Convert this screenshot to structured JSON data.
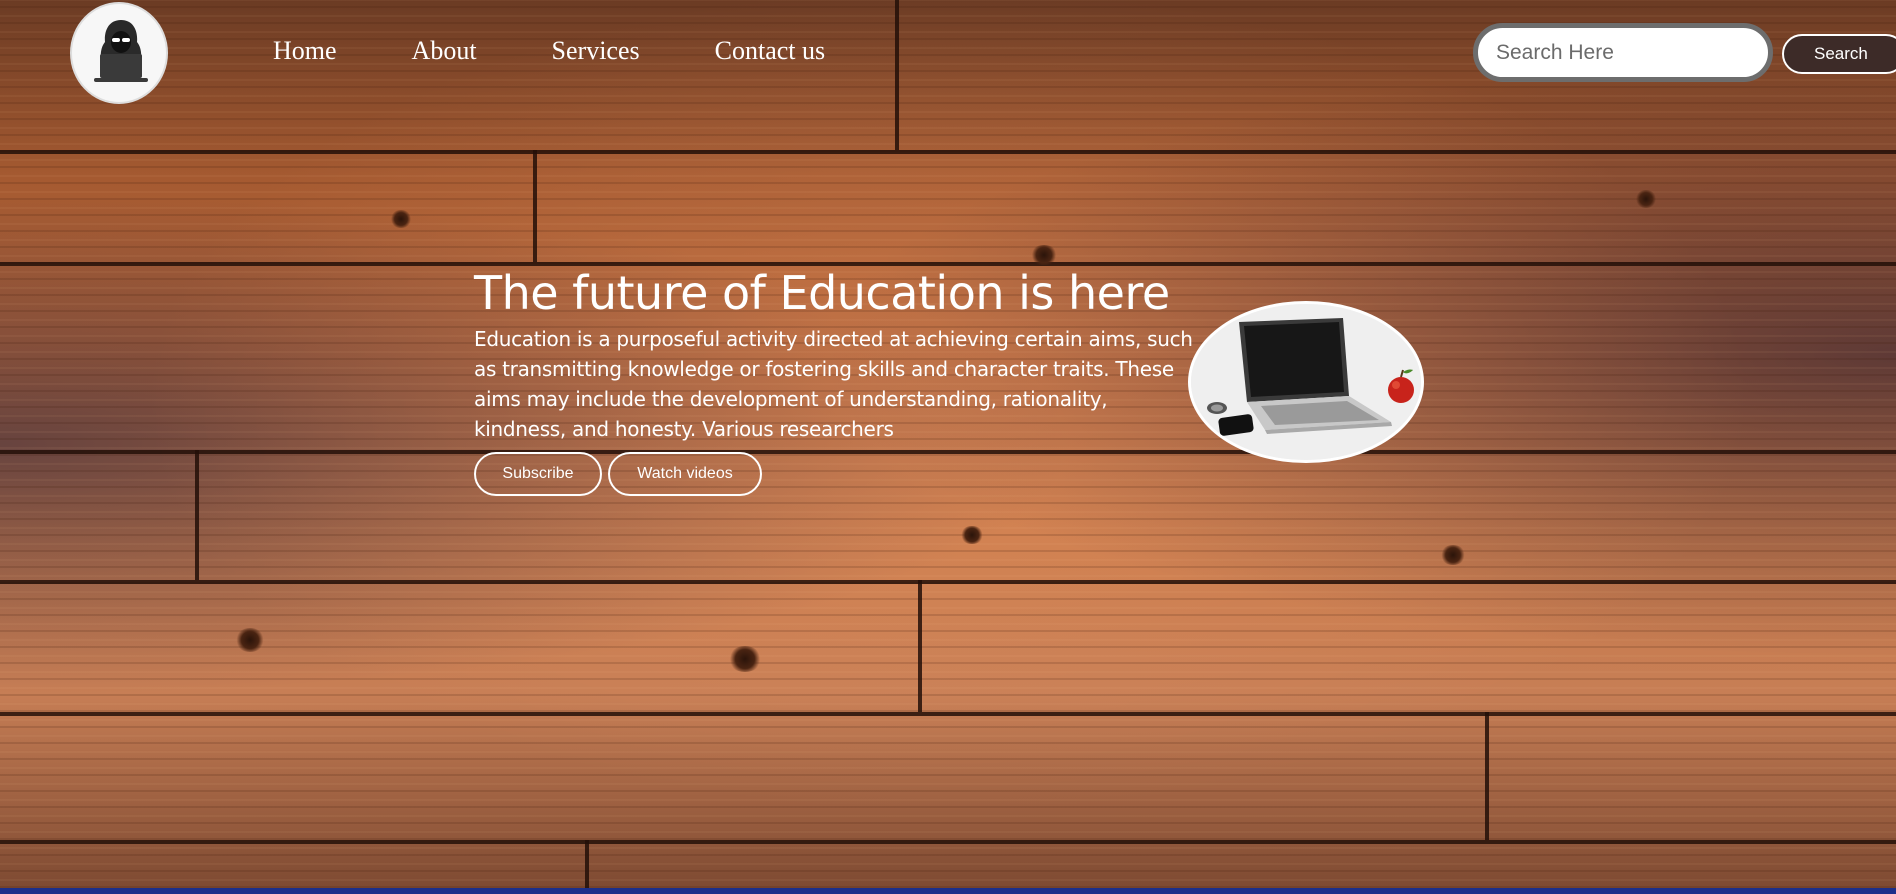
{
  "header": {
    "logo_icon": "hooded-hacker-laptop-icon",
    "nav": [
      {
        "label": "Home"
      },
      {
        "label": "About"
      },
      {
        "label": "Services"
      },
      {
        "label": "Contact us"
      }
    ],
    "search": {
      "placeholder": "Search Here",
      "value": "",
      "button_label": "Search"
    }
  },
  "hero": {
    "title": "The future of Education is here",
    "text": "Education is a purposeful activity directed at achieving certain aims, such as transmitting knowledge or fostering skills and character traits. These aims may include the development of understanding, rationality, kindness, and honesty. Various researchers",
    "buttons": {
      "subscribe": "Subscribe",
      "watch": "Watch videos"
    },
    "image_icon": "laptop-phone-apple-image"
  },
  "colors": {
    "text": "#ffffff",
    "search_button_bg": "#3d2b28",
    "bottom_bar": "#1c2f8a"
  }
}
